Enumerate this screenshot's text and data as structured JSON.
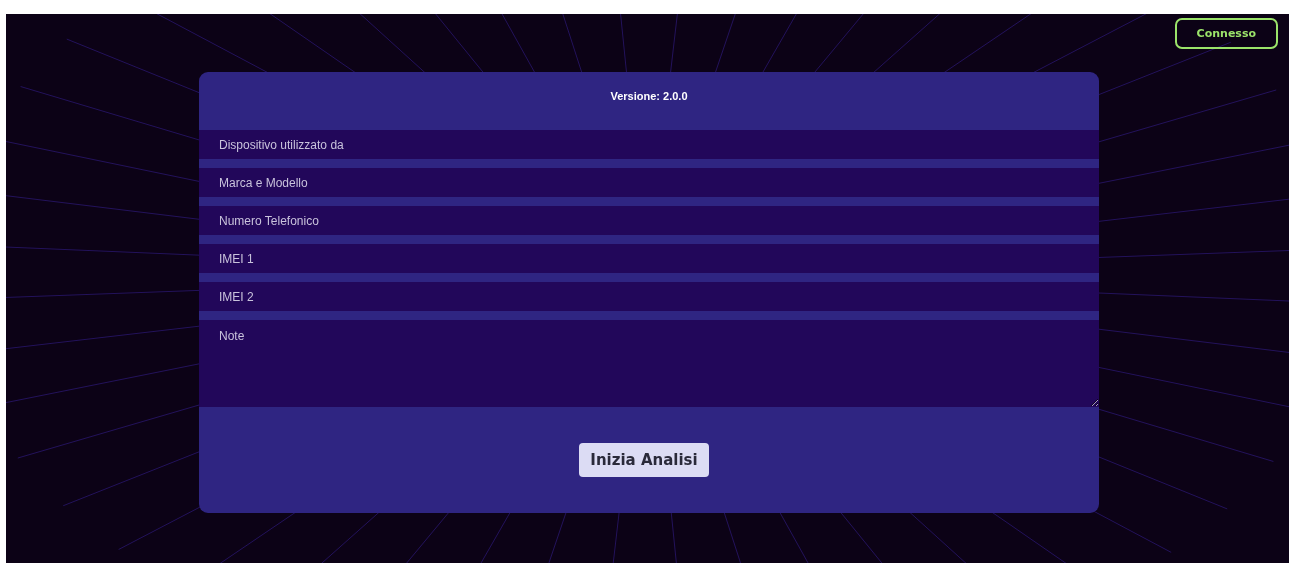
{
  "status_button": {
    "label": "Connesso"
  },
  "form": {
    "version": "Versione: 2.0.0",
    "fields": [
      {
        "kind": "input",
        "placeholder": "Dispositivo utilizzato da"
      },
      {
        "kind": "input",
        "placeholder": "Marca e Modello"
      },
      {
        "kind": "input",
        "placeholder": "Numero Telefonico"
      },
      {
        "kind": "input",
        "placeholder": "IMEI 1"
      },
      {
        "kind": "input",
        "placeholder": "IMEI 2"
      },
      {
        "kind": "textarea",
        "placeholder": "Note"
      }
    ],
    "submit_button": {
      "label": "Inizia Analisi"
    }
  }
}
